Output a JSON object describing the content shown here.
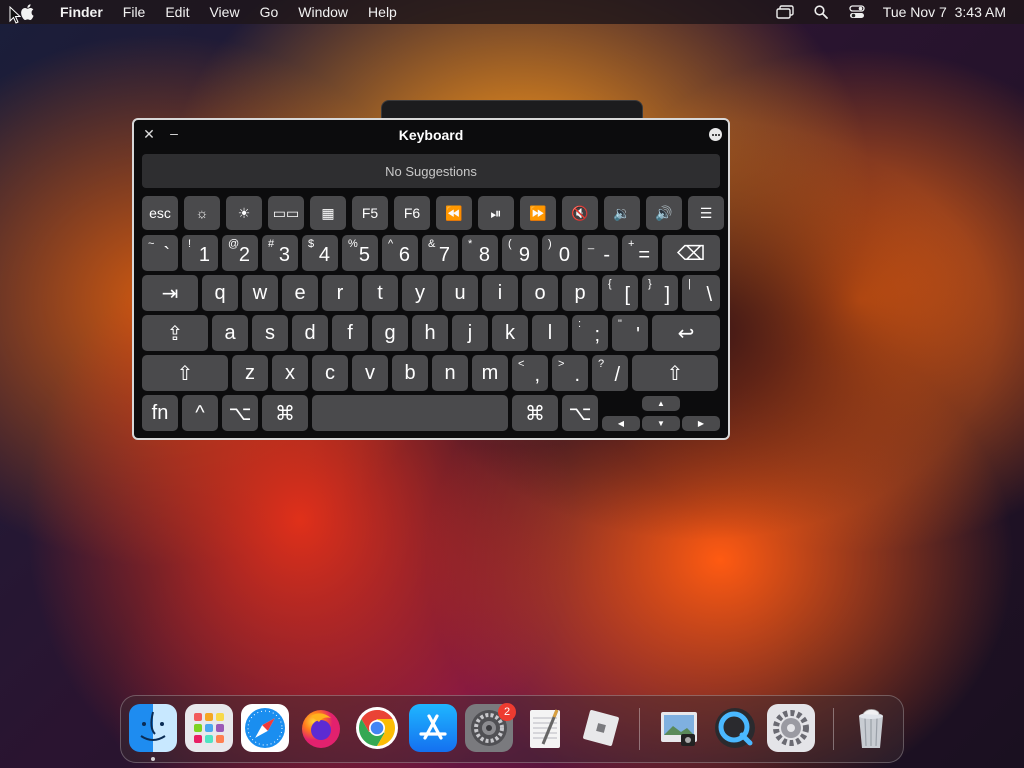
{
  "menubar": {
    "items": [
      {
        "label": "Finder",
        "bold": true
      },
      {
        "label": "File"
      },
      {
        "label": "Edit"
      },
      {
        "label": "View"
      },
      {
        "label": "Go"
      },
      {
        "label": "Window"
      },
      {
        "label": "Help"
      }
    ],
    "clock": "Tue Nov 7  3:43 AM",
    "status_icons": [
      "screen-mirroring-icon",
      "search-icon",
      "control-center-icon"
    ]
  },
  "keyboard": {
    "title": "Keyboard",
    "suggestions": "No Suggestions",
    "rows": [
      [
        {
          "label": "esc"
        },
        {
          "label": "☼",
          "icon": "brightness-down-icon"
        },
        {
          "label": "☀",
          "icon": "brightness-up-icon"
        },
        {
          "label": "▭▭",
          "icon": "mission-control-icon"
        },
        {
          "label": "▦",
          "icon": "launchpad-icon"
        },
        {
          "label": "F5"
        },
        {
          "label": "F6"
        },
        {
          "label": "⏪",
          "icon": "rewind-icon"
        },
        {
          "label": "⏯",
          "icon": "play-pause-icon"
        },
        {
          "label": "⏩",
          "icon": "fast-forward-icon"
        },
        {
          "label": "🔇",
          "icon": "mute-icon"
        },
        {
          "label": "🔉",
          "icon": "volume-down-icon"
        },
        {
          "label": "🔊",
          "icon": "volume-up-icon"
        },
        {
          "label": "☰",
          "icon": "list-icon"
        }
      ],
      [
        {
          "shift": "~",
          "main": "`"
        },
        {
          "shift": "!",
          "main": "1"
        },
        {
          "shift": "@",
          "main": "2"
        },
        {
          "shift": "#",
          "main": "3"
        },
        {
          "shift": "$",
          "main": "4"
        },
        {
          "shift": "%",
          "main": "5"
        },
        {
          "shift": "^",
          "main": "6"
        },
        {
          "shift": "&",
          "main": "7"
        },
        {
          "shift": "*",
          "main": "8"
        },
        {
          "shift": "(",
          "main": "9"
        },
        {
          "shift": ")",
          "main": "0"
        },
        {
          "shift": "_",
          "main": "-"
        },
        {
          "shift": "+",
          "main": "="
        },
        {
          "label": "⌫",
          "icon": "delete-icon"
        }
      ],
      [
        {
          "label": "⇥",
          "icon": "tab-icon"
        },
        {
          "main": "q"
        },
        {
          "main": "w"
        },
        {
          "main": "e"
        },
        {
          "main": "r"
        },
        {
          "main": "t"
        },
        {
          "main": "y"
        },
        {
          "main": "u"
        },
        {
          "main": "i"
        },
        {
          "main": "o"
        },
        {
          "main": "p"
        },
        {
          "shift": "{",
          "main": "["
        },
        {
          "shift": "}",
          "main": "]"
        },
        {
          "shift": "|",
          "main": "\\"
        }
      ],
      [
        {
          "label": "⇪",
          "icon": "caps-lock-icon"
        },
        {
          "main": "a"
        },
        {
          "main": "s"
        },
        {
          "main": "d"
        },
        {
          "main": "f"
        },
        {
          "main": "g"
        },
        {
          "main": "h"
        },
        {
          "main": "j"
        },
        {
          "main": "k"
        },
        {
          "main": "l"
        },
        {
          "shift": ":",
          "main": ";"
        },
        {
          "shift": "\"",
          "main": "'"
        },
        {
          "label": "↩",
          "icon": "return-icon"
        }
      ],
      [
        {
          "label": "⇧",
          "icon": "shift-icon"
        },
        {
          "main": "z"
        },
        {
          "main": "x"
        },
        {
          "main": "c"
        },
        {
          "main": "v"
        },
        {
          "main": "b"
        },
        {
          "main": "n"
        },
        {
          "main": "m"
        },
        {
          "shift": "<",
          "main": ","
        },
        {
          "shift": ">",
          "main": "."
        },
        {
          "shift": "?",
          "main": "/"
        },
        {
          "label": "⇧",
          "icon": "shift-icon"
        }
      ],
      [
        {
          "label": "fn"
        },
        {
          "label": "^",
          "icon": "control-icon"
        },
        {
          "label": "⌥",
          "icon": "option-icon"
        },
        {
          "label": "⌘",
          "icon": "command-icon"
        },
        {
          "label": "",
          "icon": "space-bar"
        },
        {
          "label": "⌘",
          "icon": "command-icon"
        },
        {
          "label": "⌥",
          "icon": "option-icon"
        },
        {
          "label": "◀",
          "icon": "arrow-left-icon"
        },
        {
          "label": "▲",
          "icon": "arrow-up-icon"
        },
        {
          "label": "▼",
          "icon": "arrow-down-icon"
        },
        {
          "label": "▶",
          "icon": "arrow-right-icon"
        }
      ]
    ]
  },
  "dock": {
    "apps": [
      {
        "name": "finder-icon"
      },
      {
        "name": "launchpad-icon"
      },
      {
        "name": "safari-icon"
      },
      {
        "name": "firefox-icon"
      },
      {
        "name": "chrome-icon"
      },
      {
        "name": "app-store-icon"
      },
      {
        "name": "system-settings-icon",
        "badge": "2"
      },
      {
        "name": "textedit-icon"
      },
      {
        "name": "roblox-icon"
      },
      {
        "name": "preview-icon"
      },
      {
        "name": "quicktime-icon"
      },
      {
        "name": "system-preferences-icon"
      },
      {
        "name": "trash-icon"
      }
    ]
  }
}
